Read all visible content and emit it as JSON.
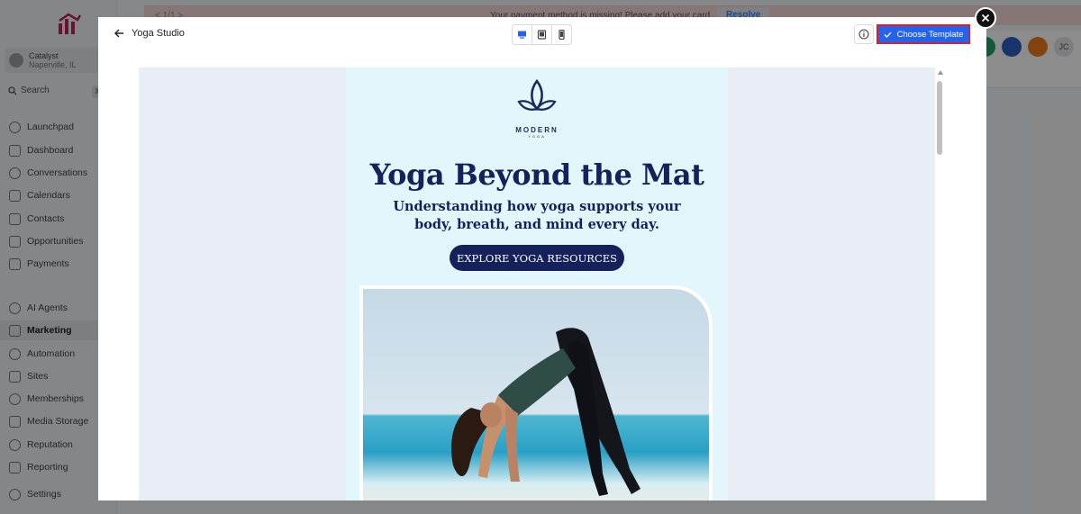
{
  "sidebar": {
    "location": {
      "name": "Catalyst",
      "city": "Naperville, IL"
    },
    "search": {
      "label": "Search",
      "shortcut": "⌘"
    },
    "items": [
      {
        "label": "Launchpad"
      },
      {
        "label": "Dashboard"
      },
      {
        "label": "Conversations"
      },
      {
        "label": "Calendars"
      },
      {
        "label": "Contacts"
      },
      {
        "label": "Opportunities"
      },
      {
        "label": "Payments"
      },
      {
        "label": "AI Agents"
      },
      {
        "label": "Marketing"
      },
      {
        "label": "Automation"
      },
      {
        "label": "Sites"
      },
      {
        "label": "Memberships"
      },
      {
        "label": "Media Storage"
      },
      {
        "label": "Reputation"
      },
      {
        "label": "Reporting"
      },
      {
        "label": "Settings"
      }
    ]
  },
  "alert": {
    "pager": "< 1/1 >",
    "message": "Your payment method is missing! Please add your card",
    "action": "Resolve"
  },
  "header": {
    "avatar_initials": "JC",
    "avatar_colors": [
      "#22a06b",
      "#2f5ec4",
      "#f07a1a",
      "#e4e4e7"
    ]
  },
  "modal": {
    "back_label": "Yoga Studio",
    "choose_label": "Choose Template",
    "accent": "#2563eb",
    "highlight": "#d8202e"
  },
  "email": {
    "brand_name": "MODERN",
    "brand_sub": "YOGA",
    "headline": "Yoga Beyond the Mat",
    "subhead": "Understanding how yoga supports your body, breath, and mind every day.",
    "cta": "EXPLORE YOGA RESOURCES",
    "colors": {
      "navy": "#14215a",
      "bg": "#e3f6fb"
    }
  }
}
